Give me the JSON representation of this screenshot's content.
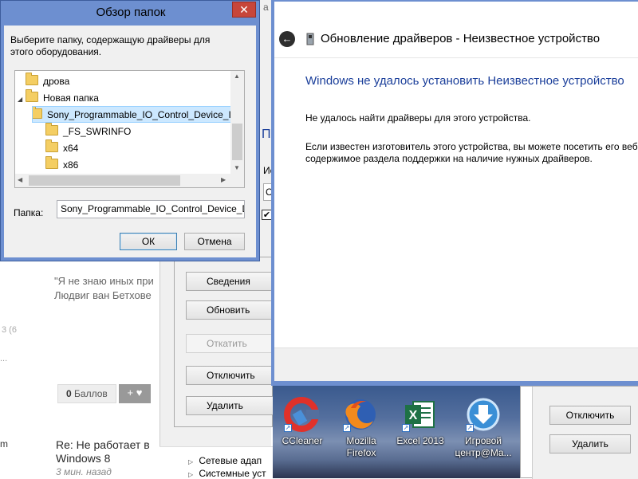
{
  "background_page": {
    "tab_fragment": "а",
    "heading_fragment": "Пе",
    "label_fragment": "Ис",
    "input_fragment": "С",
    "checkbox_mark": "✔",
    "quote_line1": "\"Я не знаю иных при",
    "quote_line2": "Людвиг ван Бетхове",
    "left_meta": "3 (6",
    "left_ellipsis": "...",
    "points_value": "0",
    "points_label": "Баллов",
    "plus_heart": "+ ♥",
    "left_m": "m",
    "reply_title1": "Re: Не работает в",
    "reply_title2": "Windows 8",
    "reply_time": "3 мин. назад",
    "tree_items": [
      "Сетевые адап",
      "Системные уст"
    ]
  },
  "properties_window": {
    "buttons": [
      "Сведения",
      "Обновить",
      "Откатить",
      "Отключить",
      "Удалить"
    ],
    "right_buttons": [
      "Отключить",
      "Удалить"
    ]
  },
  "browse_dialog": {
    "title": "Обзор папок",
    "close": "✕",
    "prompt": "Выберите папку, содержащую драйверы для этого оборудования.",
    "tree": [
      {
        "label": "дрова",
        "expander": ""
      },
      {
        "label": "Новая папка",
        "expander": "◢"
      },
      {
        "label": "Sony_Programmable_IO_Control_Device_I",
        "expander": "◢"
      },
      {
        "label": "_FS_SWRINFO",
        "expander": ""
      },
      {
        "label": "x64",
        "expander": ""
      },
      {
        "label": "x86",
        "expander": ""
      }
    ],
    "folder_label": "Папка:",
    "folder_value": "Sony_Programmable_IO_Control_Device_Driver",
    "ok": "ОК",
    "cancel": "Отмена",
    "scroll_up": "▲",
    "scroll_down": "▼",
    "scroll_left": "◀",
    "scroll_right": "▶"
  },
  "wizard": {
    "back": "←",
    "title": "Обновление драйверов - Неизвестное устройство",
    "heading": "Windows не удалось установить Неизвестное устройство",
    "text1": "Не удалось найти драйверы для этого устройства.",
    "text2_line1": "Если известен изготовитель этого устройства, вы можете посетить его веб-",
    "text2_line2": "содержимое раздела поддержки на наличие нужных драйверов."
  },
  "desktop": {
    "icons": [
      {
        "label": "CCleaner",
        "icon": "ccleaner-icon"
      },
      {
        "label": "Mozilla Firefox",
        "icon": "firefox-icon"
      },
      {
        "label": "Excel 2013",
        "icon": "excel-icon"
      },
      {
        "label": "Игровой центр@Ma...",
        "icon": "game-center-icon"
      }
    ]
  },
  "colors": {
    "dialog_frame": "#6d8fd0",
    "wizard_heading": "#1a3e9a",
    "selection": "#cce8ff"
  }
}
